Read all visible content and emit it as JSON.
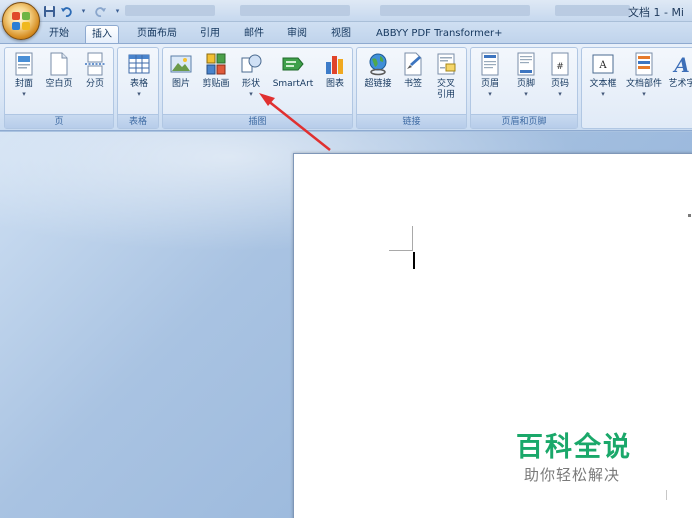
{
  "window": {
    "title": "文档 1 - Mi"
  },
  "tabs": [
    {
      "label": "开始"
    },
    {
      "label": "插入"
    },
    {
      "label": "页面布局"
    },
    {
      "label": "引用"
    },
    {
      "label": "邮件"
    },
    {
      "label": "审阅"
    },
    {
      "label": "视图"
    },
    {
      "label": "ABBYY PDF Transformer+"
    }
  ],
  "ribbon": {
    "groups": {
      "page": {
        "label": "页",
        "buttons": [
          "封面",
          "空白页",
          "分页"
        ]
      },
      "table": {
        "label": "表格",
        "buttons": [
          "表格"
        ]
      },
      "illustrations": {
        "label": "插图",
        "buttons": [
          "图片",
          "剪贴画",
          "形状",
          "SmartArt",
          "图表"
        ]
      },
      "links": {
        "label": "链接",
        "buttons": [
          "超链接",
          "书签",
          "交叉",
          "引用"
        ]
      },
      "header_footer": {
        "label": "页眉和页脚",
        "buttons": [
          "页眉",
          "页脚",
          "页码"
        ]
      },
      "text": {
        "buttons": [
          "文本框",
          "文档部件",
          "艺术字"
        ]
      }
    },
    "dropdown_arrow": "▾"
  },
  "watermark": {
    "title": "百科全说",
    "subtitle": "助你轻松解决"
  },
  "colors": {
    "accent": "#e03030",
    "watermark_green": "#1aa86a"
  }
}
